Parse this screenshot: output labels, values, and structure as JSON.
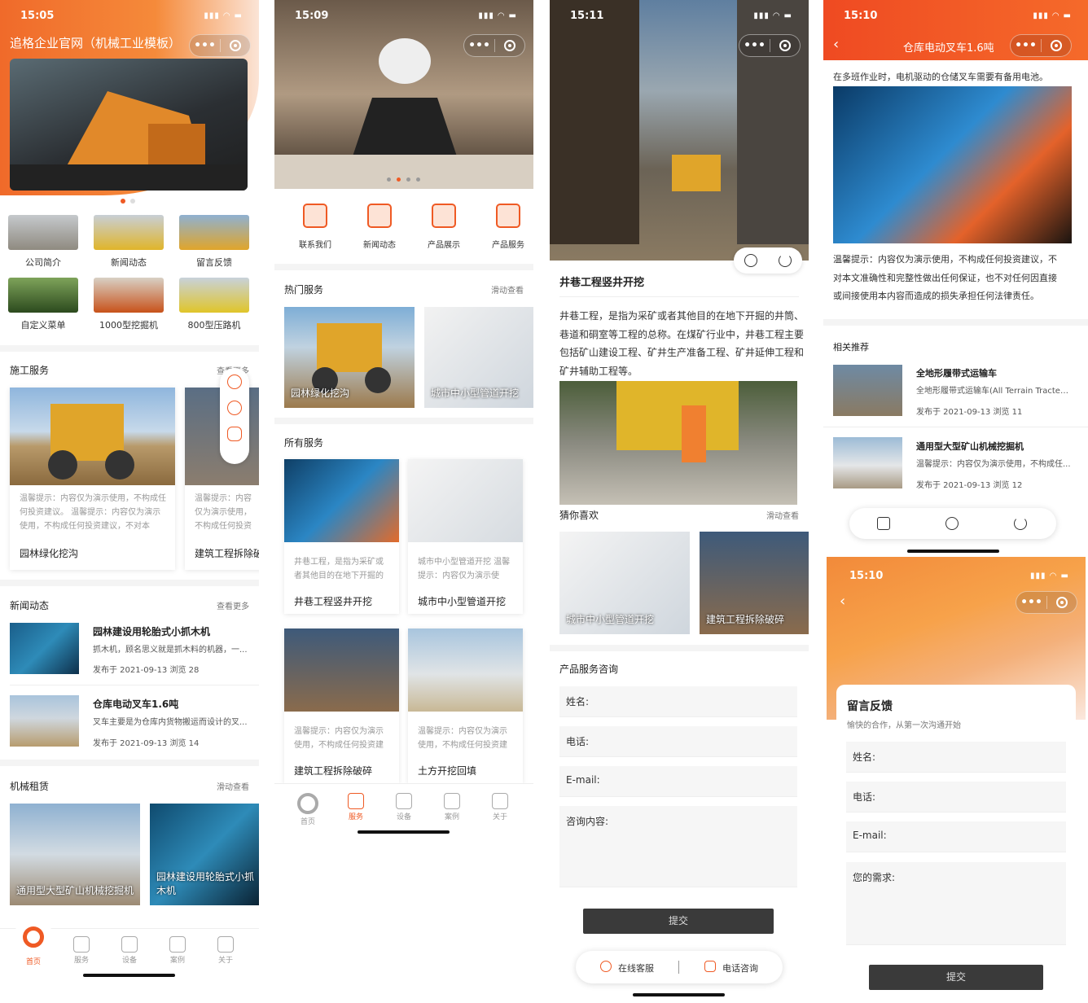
{
  "screen1": {
    "time": "15:05",
    "title": "追格企业官网（机械工业模板）",
    "grid": [
      "公司简介",
      "新闻动态",
      "留言反馈",
      "自定义菜单",
      "1000型挖掘机",
      "800型压路机"
    ],
    "construction": {
      "title": "施工服务",
      "more": "查看更多",
      "cards": [
        {
          "tip": "温馨提示：内容仅为演示使用，不构成任何投资建议。 温馨提示：内容仅为演示使用，不构成任何投资建议，不对本",
          "name": "园林绿化挖沟"
        },
        {
          "tip": "温馨提示：内容仅为演示使用，不构成任何投资建议，不对本文准确性和完整性做出任何保证，也不",
          "name": "建筑工程拆除破碎"
        }
      ]
    },
    "news": {
      "title": "新闻动态",
      "more": "查看更多",
      "items": [
        {
          "title": "园林建设用轮胎式小抓木机",
          "desc": "抓木机，顾名思义就是抓木料的机器，一...",
          "meta": "发布于 2021-09-13   浏览 28"
        },
        {
          "title": "仓库电动叉车1.6吨",
          "desc": "叉车主要是为仓库内货物搬运而设计的叉...",
          "meta": "发布于 2021-09-13   浏览 14"
        }
      ]
    },
    "rental": {
      "title": "机械租赁",
      "more": "滑动查看",
      "items": [
        "通用型大型矿山机械挖掘机",
        "园林建设用轮胎式小抓木机"
      ]
    },
    "tabs": [
      "首页",
      "服务",
      "设备",
      "案例",
      "关于"
    ]
  },
  "screen2": {
    "time": "15:09",
    "icons": [
      "联系我们",
      "新闻动态",
      "产品展示",
      "产品服务"
    ],
    "hot": {
      "title": "热门服务",
      "more": "滑动查看",
      "items": [
        "园林绿化挖沟",
        "城市中小型管道开挖"
      ]
    },
    "all": {
      "title": "所有服务",
      "cards": [
        {
          "tip": "井巷工程，是指为采矿或者其他目的在地下开掘的井",
          "name": "井巷工程竖井开挖"
        },
        {
          "tip": "城市中小型管道开挖 温馨提示：内容仅为演示使用，不",
          "name": "城市中小型管道开挖"
        },
        {
          "tip": "温馨提示：内容仅为演示使用，不构成任何投资建议，",
          "name": "建筑工程拆除破碎"
        },
        {
          "tip": "温馨提示：内容仅为演示使用，不构成任何投资建议，",
          "name": "土方开挖回填"
        }
      ]
    },
    "tabs": [
      "首页",
      "服务",
      "设备",
      "案例",
      "关于"
    ]
  },
  "screen3": {
    "time": "15:11",
    "title": "井巷工程竖井开挖",
    "body": [
      "井巷工程，是指为采矿或者其他目的在地下开掘的井筒、",
      "巷道和硐室等工程的总称。在煤矿行业中，井巷工程主要",
      "包括矿山建设工程、矿井生产准备工程、矿井延伸工程和",
      "矿井辅助工程等。"
    ],
    "guess": {
      "title": "猜你喜欢",
      "more": "滑动查看",
      "items": [
        "城市中小型管道开挖",
        "建筑工程拆除破碎"
      ]
    },
    "form": {
      "title": "产品服务咨询",
      "name": "姓名:",
      "phone": "电话:",
      "email": "E-mail:",
      "content": "咨询内容:",
      "submit": "提交"
    },
    "bottom": {
      "service": "在线客服",
      "call": "电话咨询"
    }
  },
  "screen4": {
    "time": "15:10",
    "title": "仓库电动叉车1.6吨",
    "intro": "在多班作业时，电机驱动的仓储叉车需要有备用电池。",
    "notice": [
      "温馨提示：内容仅为演示使用，不构成任何投资建议，不",
      "对本文准确性和完整性做出任何保证，也不对任何因直接",
      "或间接使用本内容而造成的损失承担任何法律责任。"
    ],
    "related": {
      "title": "相关推荐",
      "items": [
        {
          "title": "全地形履带式运输车",
          "desc": "全地形履带式运输车(All Terrain TractedC...",
          "meta": "发布于 2021-09-13   浏览 11"
        },
        {
          "title": "通用型大型矿山机械挖掘机",
          "desc": "温馨提示：内容仅为演示使用，不构成任...",
          "meta": "发布于 2021-09-13   浏览 12"
        }
      ]
    },
    "feedback": {
      "time": "15:10",
      "title": "留言反馈",
      "sub": "愉快的合作，从第一次沟通开始",
      "name": "姓名:",
      "phone": "电话:",
      "email": "E-mail:",
      "need": "您的需求:",
      "submit": "提交"
    }
  },
  "colors": {
    "accent": "#ef5a24"
  }
}
